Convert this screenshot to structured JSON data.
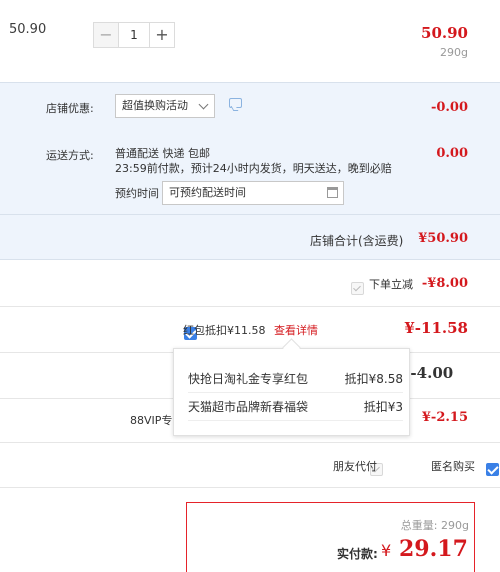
{
  "item": {
    "unit_price": "50.90",
    "quantity_minus": "−",
    "quantity": "1",
    "quantity_plus": "+",
    "total": "50.90",
    "weight": "290g"
  },
  "shop": {
    "promo_label": "店铺优惠:",
    "promo_select": "超值换购活动",
    "promo_amount": "-0.00",
    "shipping_label": "运送方式:",
    "shipping_line1": "普通配送 快递 包邮",
    "shipping_line2": "23:59前付款，预计24小时内发货，明天送达，晚到必赔",
    "appointment_label": "预约时间",
    "appointment_placeholder": "可预约配送时间",
    "shipping_amount": "0.00",
    "subtotal_label": "店铺合计(含运费)",
    "subtotal_amount": "¥50.90"
  },
  "discounts": {
    "instant_label": "下单立减",
    "instant_amount": "-¥8.00",
    "redpacket_label": "红包抵扣¥11.58",
    "redpacket_link": "查看详情",
    "redpacket_amount": "¥-11.58",
    "hidden_amount": "¥-4.00",
    "vip_label": "88VIP专",
    "vip_amount": "¥-2.15"
  },
  "popup": {
    "rows": [
      {
        "name": "快抢日淘礼金专享红包",
        "amount": "抵扣¥8.58"
      },
      {
        "name": "天猫超市品牌新春福袋",
        "amount": "抵扣¥3"
      }
    ]
  },
  "options": {
    "friend_pay": "朋友代付",
    "anonymous": "匿名购买"
  },
  "total": {
    "weight_label": "总重量:",
    "weight_value": "290g",
    "pay_label": "实付款:",
    "currency": "¥",
    "pay_amount": "29.17"
  },
  "colors": {
    "price_red": "#d4181d",
    "shop_bg": "#eef4fc",
    "checkbox_blue": "#3a80e6"
  }
}
